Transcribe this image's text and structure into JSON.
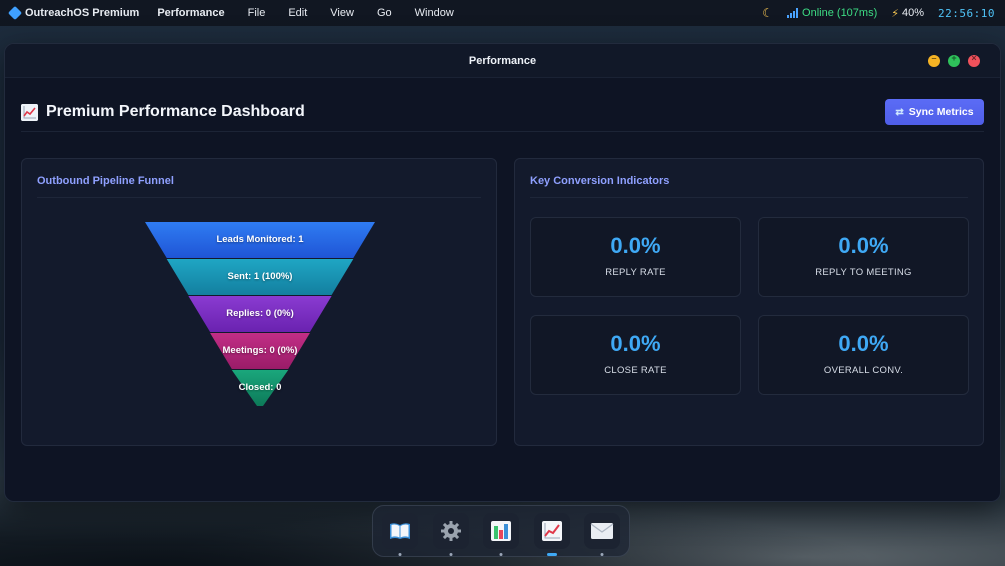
{
  "menubar": {
    "app_name": "OutreachOS Premium",
    "items": [
      "Performance",
      "File",
      "Edit",
      "View",
      "Go",
      "Window"
    ],
    "network_status": "Online (107ms)",
    "battery": "40%",
    "clock": "22:56:10"
  },
  "window": {
    "title": "Performance"
  },
  "header": {
    "title": "Premium Performance Dashboard",
    "sync_label": "Sync Metrics"
  },
  "funnel_panel": {
    "title": "Outbound Pipeline Funnel",
    "stages": [
      {
        "label": "Leads Monitored: 1",
        "color_top": "#2f7cf2",
        "color_bottom": "#1f55d6"
      },
      {
        "label": "Sent: 1 (100%)",
        "color_top": "#1fa6c4",
        "color_bottom": "#137f9f"
      },
      {
        "label": "Replies: 0 (0%)",
        "color_top": "#8a3bd1",
        "color_bottom": "#6a22b0"
      },
      {
        "label": "Meetings: 0 (0%)",
        "color_top": "#c22e86",
        "color_bottom": "#9a1c68"
      },
      {
        "label": "Closed: 0",
        "color_top": "#1aa77c",
        "color_bottom": "#0d7a59"
      }
    ]
  },
  "kpi_panel": {
    "title": "Key Conversion Indicators",
    "cards": [
      {
        "value": "0.0%",
        "label": "REPLY RATE"
      },
      {
        "value": "0.0%",
        "label": "REPLY TO MEETING"
      },
      {
        "value": "0.0%",
        "label": "CLOSE RATE"
      },
      {
        "value": "0.0%",
        "label": "OVERALL CONV."
      }
    ]
  },
  "dock": {
    "items": [
      {
        "icon": "book-icon"
      },
      {
        "icon": "gear-icon"
      },
      {
        "icon": "bar-chart-icon"
      },
      {
        "icon": "line-chart-icon",
        "active": true
      },
      {
        "icon": "mail-icon"
      }
    ]
  }
}
